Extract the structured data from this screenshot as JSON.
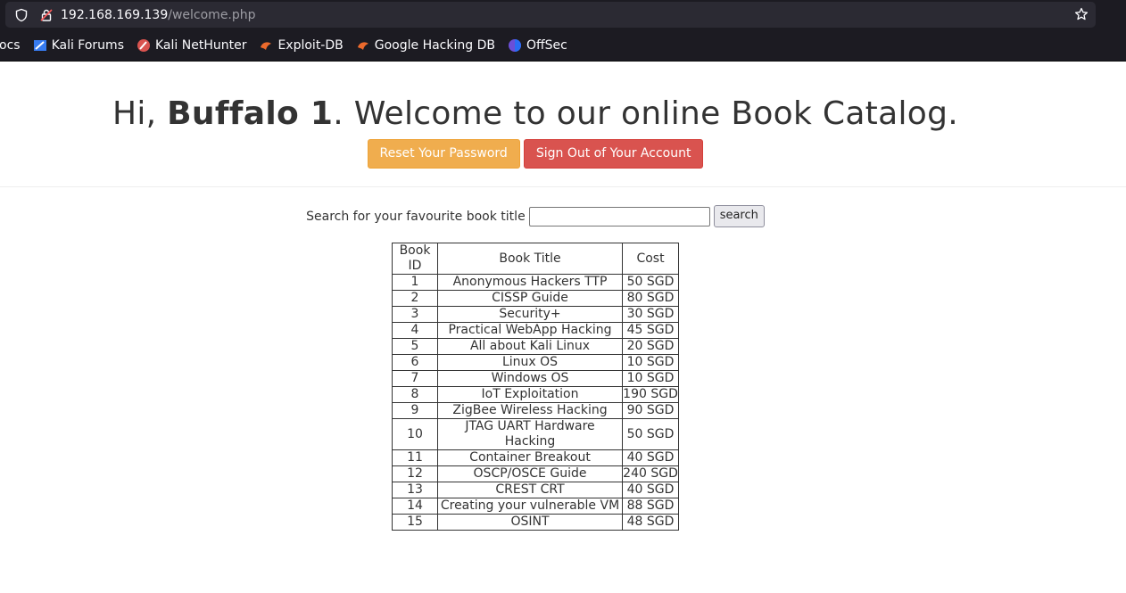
{
  "browser": {
    "url_host": "192.168.169.139",
    "url_path": "/welcome.php",
    "bookmarks": [
      {
        "label": "ocs",
        "icon": "docs-icon"
      },
      {
        "label": "Kali Forums",
        "icon": "kali-forums-icon"
      },
      {
        "label": "Kali NetHunter",
        "icon": "kali-nethunter-icon"
      },
      {
        "label": "Exploit-DB",
        "icon": "exploit-db-icon"
      },
      {
        "label": "Google Hacking DB",
        "icon": "ghdb-icon"
      },
      {
        "label": "OffSec",
        "icon": "offsec-icon"
      }
    ]
  },
  "page": {
    "greeting_prefix": "Hi, ",
    "username": "Buffalo 1",
    "greeting_suffix": ". Welcome to our online Book Catalog.",
    "reset_button": "Reset Your Password",
    "signout_button": "Sign Out of Your Account",
    "search_label": "Search for your favourite book title",
    "search_value": "",
    "search_button": "search"
  },
  "table": {
    "headers": [
      "Book ID",
      "Book Title",
      "Cost"
    ],
    "rows": [
      [
        "1",
        "Anonymous Hackers TTP",
        "50 SGD"
      ],
      [
        "2",
        "CISSP Guide",
        "80 SGD"
      ],
      [
        "3",
        "Security+",
        "30 SGD"
      ],
      [
        "4",
        "Practical WebApp Hacking",
        "45 SGD"
      ],
      [
        "5",
        "All about Kali Linux",
        "20 SGD"
      ],
      [
        "6",
        "Linux OS",
        "10 SGD"
      ],
      [
        "7",
        "Windows OS",
        "10 SGD"
      ],
      [
        "8",
        "IoT Exploitation",
        "190 SGD"
      ],
      [
        "9",
        "ZigBee Wireless Hacking",
        "90 SGD"
      ],
      [
        "10",
        "JTAG UART Hardware Hacking",
        "50 SGD"
      ],
      [
        "11",
        "Container Breakout",
        "40 SGD"
      ],
      [
        "12",
        "OSCP/OSCE Guide",
        "240 SGD"
      ],
      [
        "13",
        "CREST CRT",
        "40 SGD"
      ],
      [
        "14",
        "Creating your vulnerable VM",
        "88 SGD"
      ],
      [
        "15",
        "OSINT",
        "48 SGD"
      ]
    ]
  },
  "colors": {
    "reset_button": "#f0ad4e",
    "signout_button": "#d9534f",
    "chrome_bg": "#1c1b22"
  }
}
